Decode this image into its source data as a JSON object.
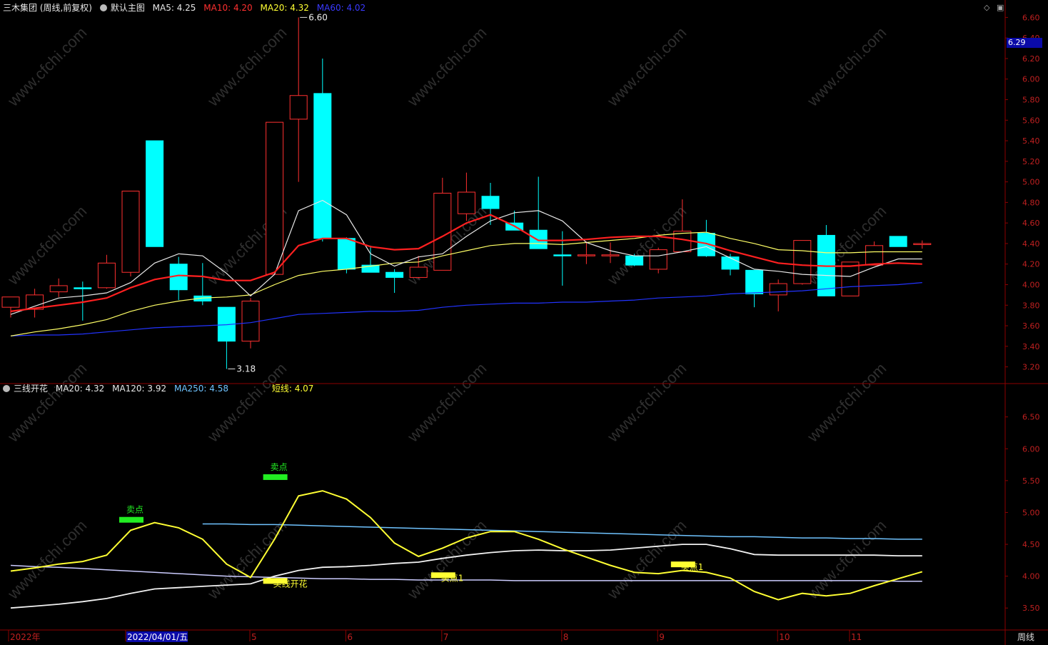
{
  "main_panel": {
    "title": "三木集团 (周线,前复权)",
    "template": "默认主图",
    "indicators": [
      {
        "label": "MA5: 4.25",
        "color": "#e8e8e8"
      },
      {
        "label": "MA10: 4.20",
        "color": "#ff3030"
      },
      {
        "label": "MA20: 4.32",
        "color": "#ffff33"
      },
      {
        "label": "MA60: 4.02",
        "color": "#3a3aff"
      }
    ],
    "high_label": "6.60",
    "low_label": "3.18",
    "current_price": "6.29",
    "y_ticks": [
      "6.60",
      "6.40",
      "6.20",
      "6.00",
      "5.80",
      "5.60",
      "5.40",
      "5.20",
      "5.00",
      "4.80",
      "4.60",
      "4.40",
      "4.20",
      "4.00",
      "3.80",
      "3.60",
      "3.40",
      "3.20"
    ]
  },
  "sub_panel": {
    "title": "三线开花",
    "indicators": [
      {
        "label": "MA20: 4.32",
        "color": "#e8e8e8"
      },
      {
        "label": "MA120: 3.92",
        "color": "#e8e8e8"
      },
      {
        "label": "MA250: 4.58",
        "color": "#6fc3ff"
      },
      {
        "label": "短线: 4.07",
        "color": "#ffff33"
      }
    ],
    "y_ticks": [
      "6.50",
      "6.00",
      "5.50",
      "5.00",
      "4.50",
      "4.00",
      "3.50"
    ],
    "signals": [
      {
        "text": "卖点",
        "color": "#22ee22",
        "pos": 5
      },
      {
        "text": "卖点",
        "color": "#22ee22",
        "pos": 11
      },
      {
        "text": "买线开花",
        "color": "#ffff33",
        "pos": 11
      },
      {
        "text": "买点1",
        "color": "#ffff33",
        "pos": 18
      },
      {
        "text": "买点1",
        "color": "#ffff33",
        "pos": 28
      }
    ]
  },
  "x_axis": {
    "labels": [
      {
        "text": "2022年",
        "i": 0
      },
      {
        "text": "2022/04/01/五",
        "i": 5
      },
      {
        "text": "5",
        "i": 10
      },
      {
        "text": "6",
        "i": 14
      },
      {
        "text": "7",
        "i": 18
      },
      {
        "text": "8",
        "i": 23
      },
      {
        "text": "9",
        "i": 27
      },
      {
        "text": "10",
        "i": 32
      },
      {
        "text": "11",
        "i": 35
      }
    ],
    "period_button": "周线"
  },
  "colors": {
    "up": "#ff3030",
    "down": "#00ffff",
    "ma5": "#e8e8e8",
    "ma10": "#ff2020",
    "ma20": "#ffff66",
    "ma60": "#2233ff",
    "axis": "#8b0000",
    "ma250": "#6fc3ff",
    "ma120": "#ccccff",
    "short": "#ffff33",
    "watermark": "#555555"
  },
  "watermark": "www.cfchi.com",
  "chart_data": {
    "type": "candlestick",
    "period": "weekly",
    "candles": [
      {
        "o": 3.78,
        "h": 3.86,
        "l": 3.68,
        "c": 3.88
      },
      {
        "o": 3.76,
        "h": 3.96,
        "l": 3.68,
        "c": 3.9
      },
      {
        "o": 3.93,
        "h": 4.06,
        "l": 3.88,
        "c": 3.99
      },
      {
        "o": 3.97,
        "h": 4.03,
        "l": 3.65,
        "c": 3.96
      },
      {
        "o": 3.97,
        "h": 4.29,
        "l": 3.96,
        "c": 4.21
      },
      {
        "o": 4.12,
        "h": 4.91,
        "l": 4.08,
        "c": 4.91
      },
      {
        "o": 5.4,
        "h": 5.4,
        "l": 4.37,
        "c": 4.37
      },
      {
        "o": 4.2,
        "h": 4.27,
        "l": 3.85,
        "c": 3.95
      },
      {
        "o": 3.89,
        "h": 4.21,
        "l": 3.8,
        "c": 3.84
      },
      {
        "o": 3.78,
        "h": 3.78,
        "l": 3.18,
        "c": 3.45
      },
      {
        "o": 3.45,
        "h": 3.87,
        "l": 3.38,
        "c": 3.84
      },
      {
        "o": 4.1,
        "h": 5.58,
        "l": 4.1,
        "c": 5.58
      },
      {
        "o": 5.61,
        "h": 6.6,
        "l": 5.0,
        "c": 5.84
      },
      {
        "o": 5.86,
        "h": 6.2,
        "l": 4.42,
        "c": 4.45
      },
      {
        "o": 4.45,
        "h": 4.46,
        "l": 4.11,
        "c": 4.15
      },
      {
        "o": 4.19,
        "h": 4.38,
        "l": 4.15,
        "c": 4.12
      },
      {
        "o": 4.12,
        "h": 4.15,
        "l": 3.92,
        "c": 4.07
      },
      {
        "o": 4.07,
        "h": 4.28,
        "l": 4.06,
        "c": 4.17
      },
      {
        "o": 4.14,
        "h": 5.04,
        "l": 4.14,
        "c": 4.89
      },
      {
        "o": 4.69,
        "h": 5.09,
        "l": 4.62,
        "c": 4.9
      },
      {
        "o": 4.86,
        "h": 4.99,
        "l": 4.58,
        "c": 4.74
      },
      {
        "o": 4.6,
        "h": 4.72,
        "l": 4.55,
        "c": 4.53
      },
      {
        "o": 4.53,
        "h": 5.05,
        "l": 4.35,
        "c": 4.35
      },
      {
        "o": 4.29,
        "h": 4.52,
        "l": 3.99,
        "c": 4.28
      },
      {
        "o": 4.29,
        "h": 4.42,
        "l": 4.2,
        "c": 4.29
      },
      {
        "o": 4.29,
        "h": 4.41,
        "l": 4.21,
        "c": 4.29
      },
      {
        "o": 4.28,
        "h": 4.3,
        "l": 4.18,
        "c": 4.19
      },
      {
        "o": 4.15,
        "h": 4.36,
        "l": 4.11,
        "c": 4.34
      },
      {
        "o": 4.32,
        "h": 4.83,
        "l": 4.32,
        "c": 4.52
      },
      {
        "o": 4.5,
        "h": 4.63,
        "l": 4.27,
        "c": 4.28
      },
      {
        "o": 4.27,
        "h": 4.3,
        "l": 4.09,
        "c": 4.15
      },
      {
        "o": 4.14,
        "h": 4.14,
        "l": 3.78,
        "c": 3.91
      },
      {
        "o": 3.9,
        "h": 4.05,
        "l": 3.74,
        "c": 4.01
      },
      {
        "o": 4.01,
        "h": 4.43,
        "l": 4.0,
        "c": 4.43
      },
      {
        "o": 4.48,
        "h": 4.58,
        "l": 3.89,
        "c": 3.89
      },
      {
        "o": 3.89,
        "h": 4.22,
        "l": 3.89,
        "c": 4.22
      },
      {
        "o": 4.19,
        "h": 4.42,
        "l": 4.19,
        "c": 4.38
      },
      {
        "o": 4.47,
        "h": 4.47,
        "l": 4.37,
        "c": 4.37
      },
      {
        "o": 4.4,
        "h": 4.43,
        "l": 4.35,
        "c": 4.4
      }
    ],
    "ma5": [
      3.71,
      3.79,
      3.87,
      3.89,
      3.92,
      4.02,
      4.21,
      4.3,
      4.28,
      4.11,
      3.89,
      4.1,
      4.72,
      4.82,
      4.68,
      4.3,
      4.18,
      4.27,
      4.3,
      4.47,
      4.62,
      4.7,
      4.72,
      4.62,
      4.41,
      4.33,
      4.28,
      4.28,
      4.32,
      4.37,
      4.26,
      4.15,
      4.13,
      4.1,
      4.09,
      4.08,
      4.17,
      4.25,
      4.25
    ],
    "ma10": [
      3.74,
      3.77,
      3.8,
      3.83,
      3.87,
      3.97,
      4.05,
      4.09,
      4.08,
      4.04,
      4.04,
      4.12,
      4.38,
      4.45,
      4.45,
      4.37,
      4.34,
      4.35,
      4.47,
      4.6,
      4.68,
      4.57,
      4.43,
      4.43,
      4.44,
      4.46,
      4.47,
      4.47,
      4.44,
      4.4,
      4.33,
      4.27,
      4.21,
      4.19,
      4.18,
      4.18,
      4.2,
      4.21,
      4.2
    ],
    "ma20": [
      3.5,
      3.54,
      3.57,
      3.61,
      3.66,
      3.74,
      3.8,
      3.84,
      3.87,
      3.88,
      3.9,
      4.0,
      4.09,
      4.13,
      4.15,
      4.18,
      4.21,
      4.22,
      4.28,
      4.33,
      4.38,
      4.4,
      4.4,
      4.39,
      4.41,
      4.43,
      4.45,
      4.48,
      4.5,
      4.51,
      4.45,
      4.4,
      4.34,
      4.33,
      4.31,
      4.31,
      4.32,
      4.32,
      4.32
    ],
    "ma60": [
      3.5,
      3.51,
      3.51,
      3.52,
      3.54,
      3.56,
      3.58,
      3.59,
      3.6,
      3.61,
      3.63,
      3.67,
      3.71,
      3.72,
      3.73,
      3.74,
      3.74,
      3.75,
      3.78,
      3.8,
      3.81,
      3.82,
      3.82,
      3.83,
      3.83,
      3.84,
      3.85,
      3.87,
      3.88,
      3.89,
      3.91,
      3.92,
      3.93,
      3.94,
      3.96,
      3.98,
      3.99,
      4.0,
      4.02
    ],
    "sub_ma120": [
      4.17,
      4.15,
      4.14,
      4.12,
      4.1,
      4.08,
      4.06,
      4.04,
      4.02,
      4.0,
      3.99,
      3.98,
      3.97,
      3.96,
      3.96,
      3.95,
      3.95,
      3.94,
      3.94,
      3.94,
      3.94,
      3.93,
      3.93,
      3.93,
      3.93,
      3.93,
      3.93,
      3.93,
      3.93,
      3.93,
      3.93,
      3.93,
      3.93,
      3.93,
      3.93,
      3.93,
      3.93,
      3.92,
      3.92
    ],
    "sub_ma20": [
      3.5,
      3.53,
      3.56,
      3.6,
      3.65,
      3.73,
      3.8,
      3.82,
      3.84,
      3.86,
      3.88,
      4.0,
      4.09,
      4.14,
      4.15,
      4.17,
      4.2,
      4.22,
      4.28,
      4.33,
      4.37,
      4.4,
      4.41,
      4.4,
      4.4,
      4.41,
      4.44,
      4.47,
      4.5,
      4.5,
      4.43,
      4.34,
      4.33,
      4.33,
      4.33,
      4.33,
      4.33,
      4.32,
      4.32
    ],
    "sub_ma250_start": 8,
    "sub_ma250": [
      4.82,
      4.82,
      4.81,
      4.81,
      4.8,
      4.79,
      4.78,
      4.77,
      4.76,
      4.75,
      4.74,
      4.73,
      4.72,
      4.71,
      4.7,
      4.69,
      4.68,
      4.67,
      4.66,
      4.65,
      4.64,
      4.63,
      4.62,
      4.62,
      4.61,
      4.6,
      4.6,
      4.59,
      4.59,
      4.58,
      4.58
    ],
    "sub_short": [
      4.08,
      4.13,
      4.19,
      4.23,
      4.33,
      4.72,
      4.84,
      4.76,
      4.58,
      4.19,
      3.98,
      4.58,
      5.26,
      5.34,
      5.21,
      4.92,
      4.52,
      4.31,
      4.44,
      4.6,
      4.7,
      4.7,
      4.58,
      4.43,
      4.3,
      4.17,
      4.06,
      4.04,
      4.09,
      4.06,
      3.97,
      3.76,
      3.63,
      3.73,
      3.69,
      3.73,
      3.85,
      3.96,
      4.07
    ],
    "main_ylim": [
      3.1,
      6.7
    ],
    "sub_ylim": [
      3.2,
      6.9
    ]
  }
}
